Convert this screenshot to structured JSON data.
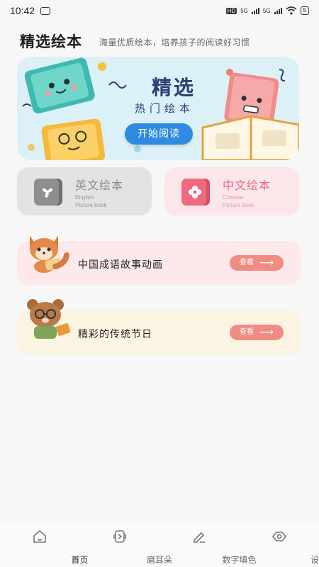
{
  "status_bar": {
    "time": "10:42",
    "network_badge": "HD",
    "signal_1": "5G",
    "signal_2": "5G",
    "battery": "5"
  },
  "header": {
    "title": "精选绘本",
    "subtitle": "海量优质绘本，培养孩子的阅读好习惯"
  },
  "banner": {
    "title": "精选",
    "subtitle": "热门绘本",
    "button_label": "开始阅读",
    "accent_color": "#2f8ae0"
  },
  "categories": [
    {
      "label": "英文绘本",
      "sub_line_1": "English",
      "sub_line_2": "Picture book",
      "color": "#8a8a8a"
    },
    {
      "label": "中文绘本",
      "sub_line_1": "Chinese",
      "sub_line_2": "Picture book",
      "color": "#e4697c"
    }
  ],
  "stories": [
    {
      "label": "中国成语故事动画",
      "button_label": "查看",
      "button_arrow": "⟶"
    },
    {
      "label": "精彩的传统节日",
      "button_label": "查看",
      "button_arrow": "⟶"
    }
  ],
  "bottom_nav": [
    {
      "label": "首页",
      "icon": "home-icon",
      "active": true
    },
    {
      "label": "磨耳朵",
      "icon": "ear-icon",
      "active": false
    },
    {
      "label": "数字填色",
      "icon": "pen-icon",
      "active": false
    },
    {
      "label": "设置",
      "icon": "eye-icon",
      "active": false
    }
  ]
}
